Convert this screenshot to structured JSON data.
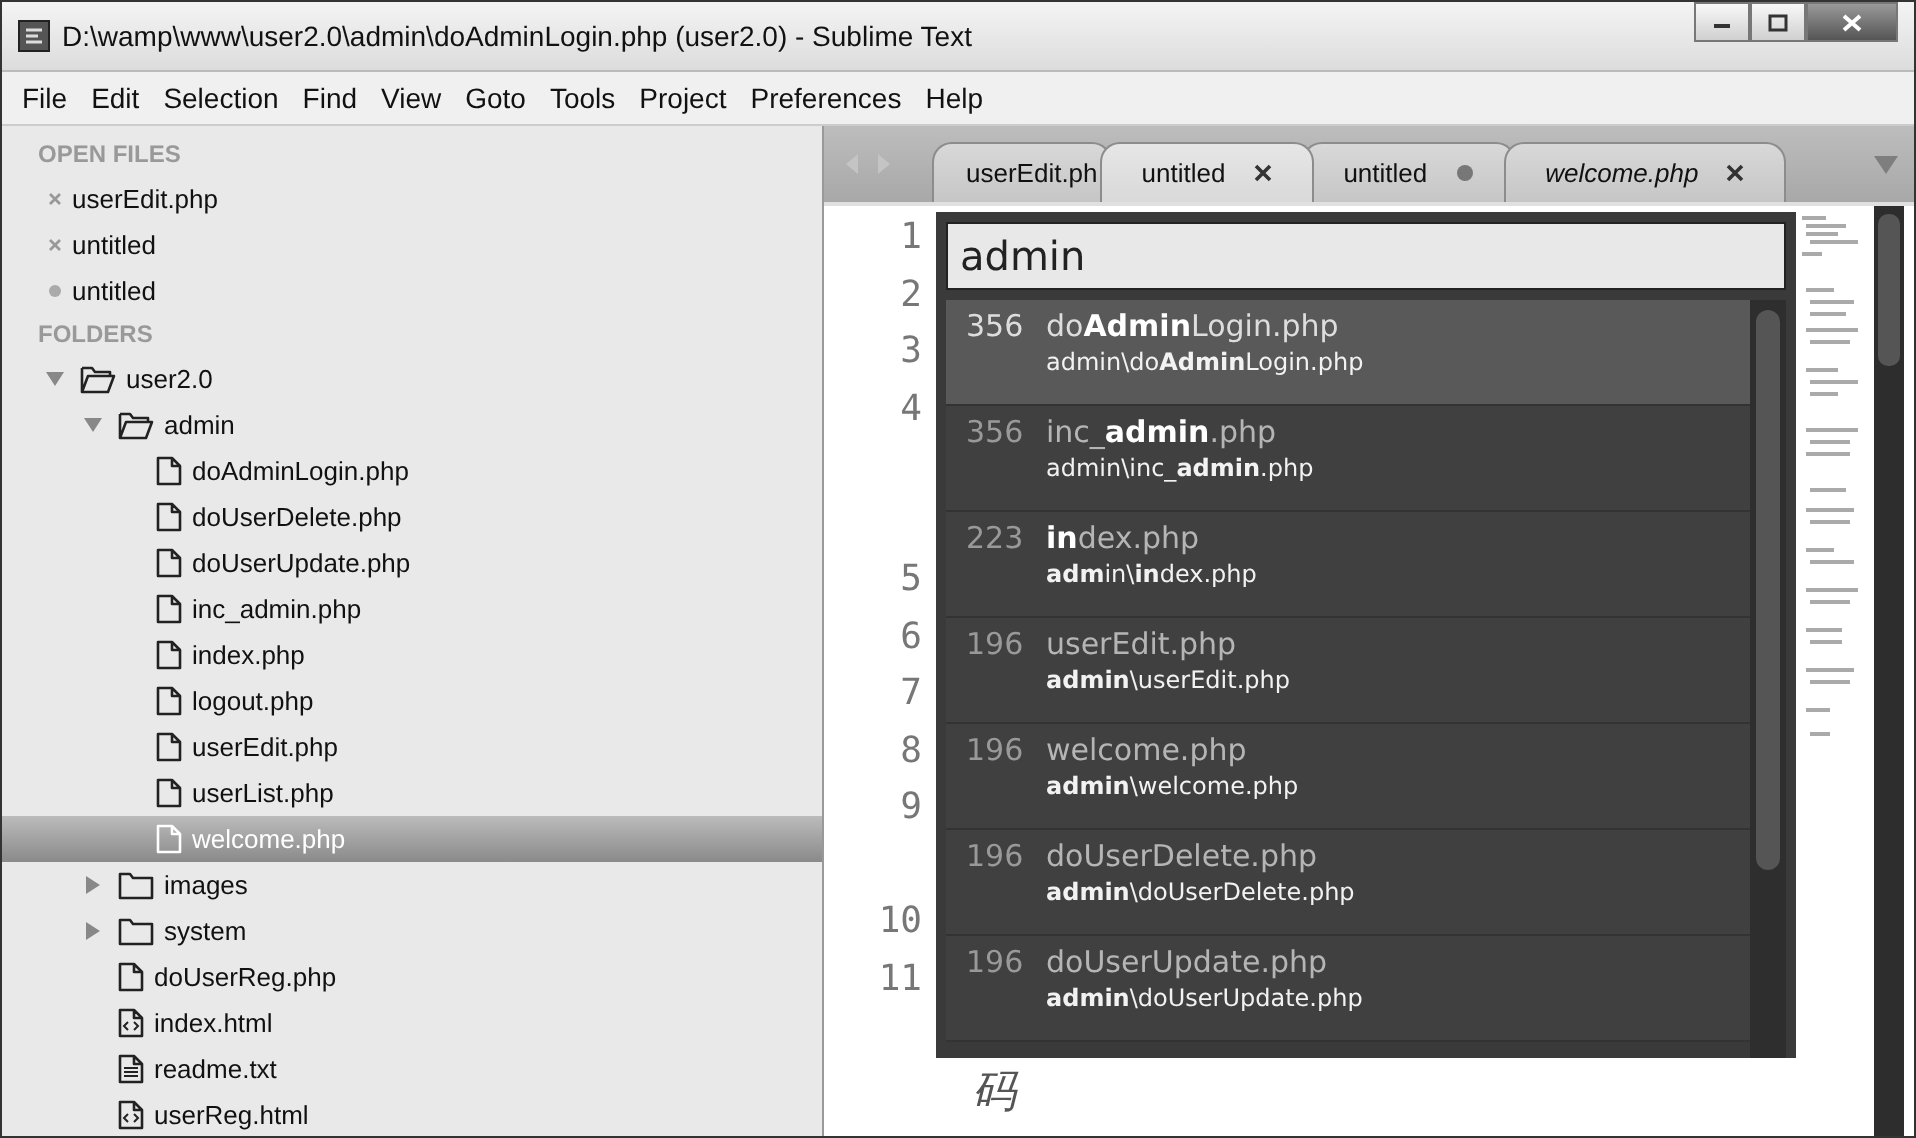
{
  "window": {
    "title": "D:\\wamp\\www\\user2.0\\admin\\doAdminLogin.php (user2.0) - Sublime Text"
  },
  "menu": [
    "File",
    "Edit",
    "Selection",
    "Find",
    "View",
    "Goto",
    "Tools",
    "Project",
    "Preferences",
    "Help"
  ],
  "sidebar": {
    "open_files_heading": "OPEN FILES",
    "open_files": [
      {
        "name": "userEdit.php",
        "modified": false
      },
      {
        "name": "untitled",
        "modified": false
      },
      {
        "name": "untitled",
        "modified": true
      }
    ],
    "folders_heading": "FOLDERS",
    "folders": [
      {
        "name": "user2.0",
        "kind": "folder",
        "expanded": true,
        "children": [
          {
            "name": "admin",
            "kind": "folder",
            "expanded": true,
            "children": [
              {
                "name": "doAdminLogin.php",
                "kind": "file",
                "selected": false
              },
              {
                "name": "doUserDelete.php",
                "kind": "file",
                "selected": false
              },
              {
                "name": "doUserUpdate.php",
                "kind": "file",
                "selected": false
              },
              {
                "name": "inc_admin.php",
                "kind": "file",
                "selected": false
              },
              {
                "name": "index.php",
                "kind": "file",
                "selected": false
              },
              {
                "name": "logout.php",
                "kind": "file",
                "selected": false
              },
              {
                "name": "userEdit.php",
                "kind": "file",
                "selected": false
              },
              {
                "name": "userList.php",
                "kind": "file",
                "selected": false
              },
              {
                "name": "welcome.php",
                "kind": "file",
                "selected": true
              }
            ]
          },
          {
            "name": "images",
            "kind": "folder",
            "expanded": false
          },
          {
            "name": "system",
            "kind": "folder",
            "expanded": false
          },
          {
            "name": "doUserReg.php",
            "kind": "file",
            "selected": false
          },
          {
            "name": "index.html",
            "kind": "markup",
            "selected": false
          },
          {
            "name": "readme.txt",
            "kind": "text",
            "selected": false
          },
          {
            "name": "userReg.html",
            "kind": "markup",
            "selected": false
          }
        ]
      }
    ]
  },
  "tabs": [
    {
      "label": "userEdit.ph",
      "selected": false,
      "preview": false
    },
    {
      "label": "untitled",
      "selected": true,
      "modified": false,
      "preview": false
    },
    {
      "label": "untitled",
      "selected": false,
      "modified": true,
      "preview": false
    },
    {
      "label": "welcome.php",
      "selected": false,
      "modified": false,
      "preview": true
    }
  ],
  "editor": {
    "lines": [
      {
        "number": "1",
        "kind": "single"
      },
      {
        "number": "2",
        "kind": "single"
      },
      {
        "number": "3",
        "kind": "single"
      },
      {
        "number": "4",
        "kind": "triple"
      },
      {
        "number": "5",
        "kind": "single"
      },
      {
        "number": "6",
        "kind": "single"
      },
      {
        "number": "7",
        "kind": "single"
      },
      {
        "number": "8",
        "kind": "single"
      },
      {
        "number": "9",
        "kind": "double"
      },
      {
        "number": "10",
        "kind": "single"
      },
      {
        "number": "11",
        "kind": "triple",
        "tail_text": "码"
      }
    ]
  },
  "goto_anything": {
    "query": "admin",
    "results": [
      {
        "score": "356",
        "name": "do**Admin**Login.php",
        "path": "admin\\do**Admin**Login.php",
        "selected": true
      },
      {
        "score": "356",
        "name": "inc_**admin**.php",
        "path": "admin\\inc_**admin**.php",
        "selected": false
      },
      {
        "score": "223",
        "name": "**in**dex.php",
        "path": "**adm**in\\**in**dex.php",
        "selected": false
      },
      {
        "score": "196",
        "name": "userEdit.php",
        "path": "**admin**\\userEdit.php",
        "selected": false
      },
      {
        "score": "196",
        "name": "welcome.php",
        "path": "**admin**\\welcome.php",
        "selected": false
      },
      {
        "score": "196",
        "name": "doUserDelete.php",
        "path": "**admin**\\doUserDelete.php",
        "selected": false
      },
      {
        "score": "196",
        "name": "doUserUpdate.php",
        "path": "**admin**\\doUserUpdate.php",
        "selected": false
      }
    ]
  }
}
